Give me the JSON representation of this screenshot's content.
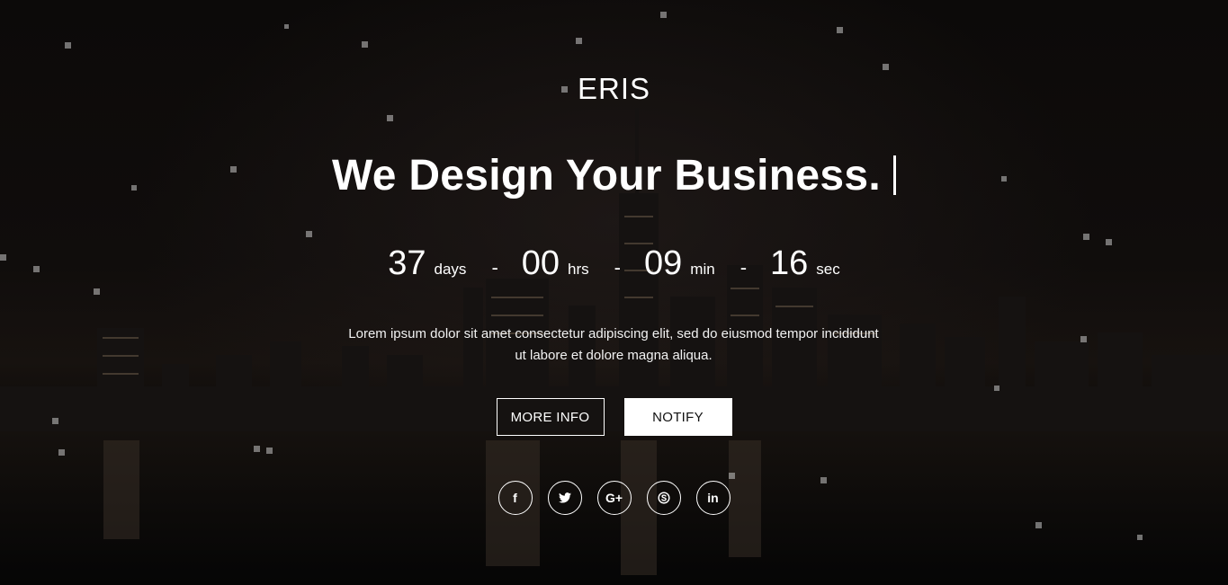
{
  "brand": {
    "logo": "ERIS"
  },
  "hero": {
    "headline": "We Design Your Business."
  },
  "countdown": [
    {
      "value": "37",
      "label": "days"
    },
    {
      "value": "00",
      "label": "hrs"
    },
    {
      "value": "09",
      "label": "min"
    },
    {
      "value": "16",
      "label": "sec"
    }
  ],
  "countdown_separator": "-",
  "description": "Lorem ipsum dolor sit amet consectetur adipiscing elit, sed do eiusmod tempor incididunt ut labore et dolore magna aliqua.",
  "buttons": {
    "more_info": "MORE INFO",
    "notify": "NOTIFY"
  },
  "social": [
    {
      "name": "facebook-icon",
      "glyph": "f"
    },
    {
      "name": "twitter-icon",
      "glyph": ""
    },
    {
      "name": "google-plus-icon",
      "glyph": "G+"
    },
    {
      "name": "skype-icon",
      "glyph": ""
    },
    {
      "name": "linkedin-icon",
      "glyph": "in"
    }
  ],
  "colors": {
    "background": "#0b0908",
    "text": "#ffffff",
    "button_solid": "#ffffff",
    "button_solid_text": "#111111"
  }
}
